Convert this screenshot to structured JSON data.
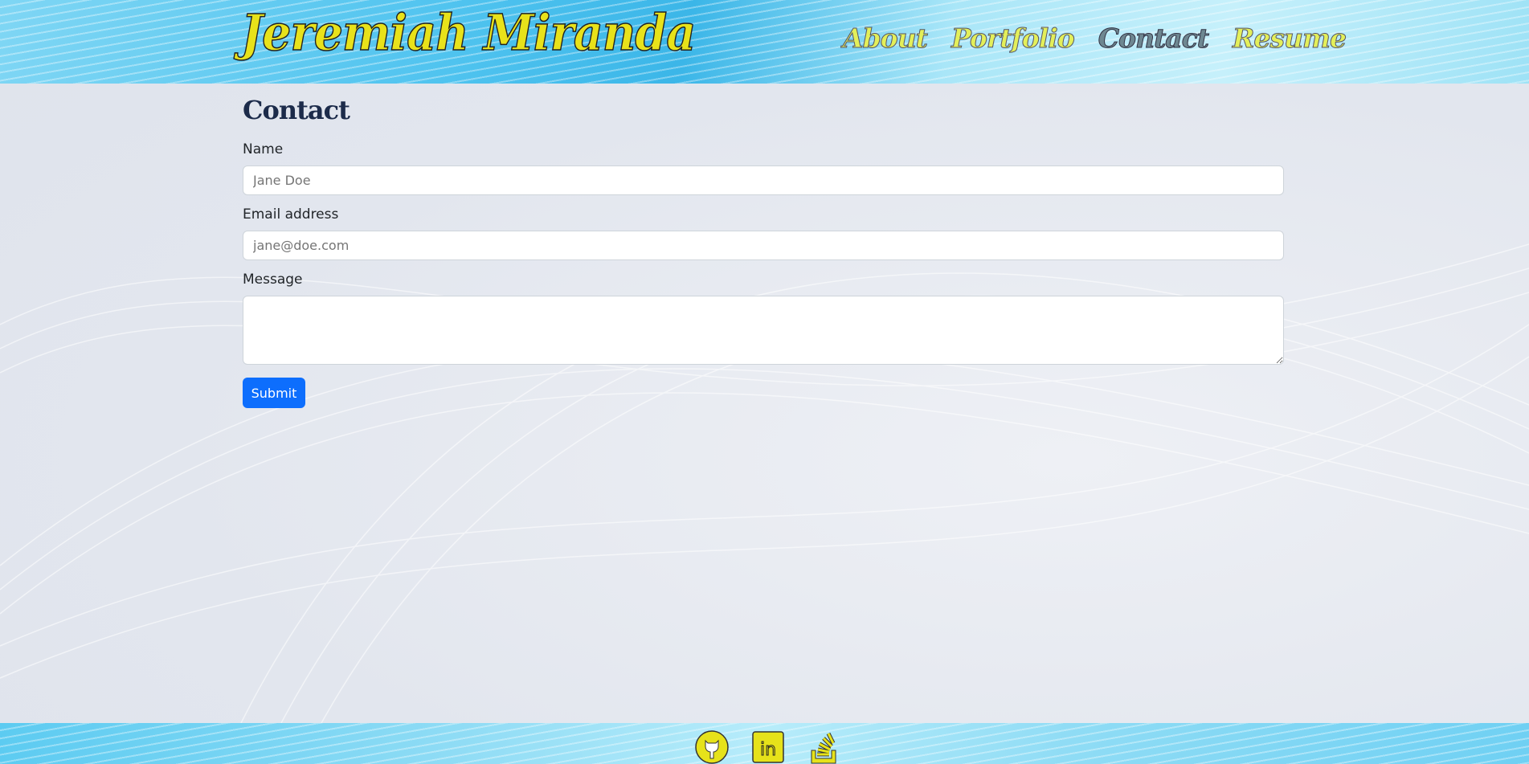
{
  "header": {
    "brand": "Jeremiah Miranda",
    "nav": [
      {
        "label": "About"
      },
      {
        "label": "Portfolio"
      },
      {
        "label": "Contact",
        "active": true
      },
      {
        "label": "Resume"
      }
    ]
  },
  "main": {
    "title": "Contact",
    "name": {
      "label": "Name",
      "placeholder": "Jane Doe"
    },
    "email": {
      "label": "Email address",
      "placeholder": "jane@doe.com"
    },
    "message": {
      "label": "Message",
      "placeholder": ""
    },
    "submit_label": "Submit"
  },
  "footer": {
    "icons": [
      "github-icon",
      "linkedin-icon",
      "stackoverflow-icon"
    ]
  },
  "colors": {
    "accent": "#0d6efd",
    "logo_yellow": "#e8e21a"
  }
}
